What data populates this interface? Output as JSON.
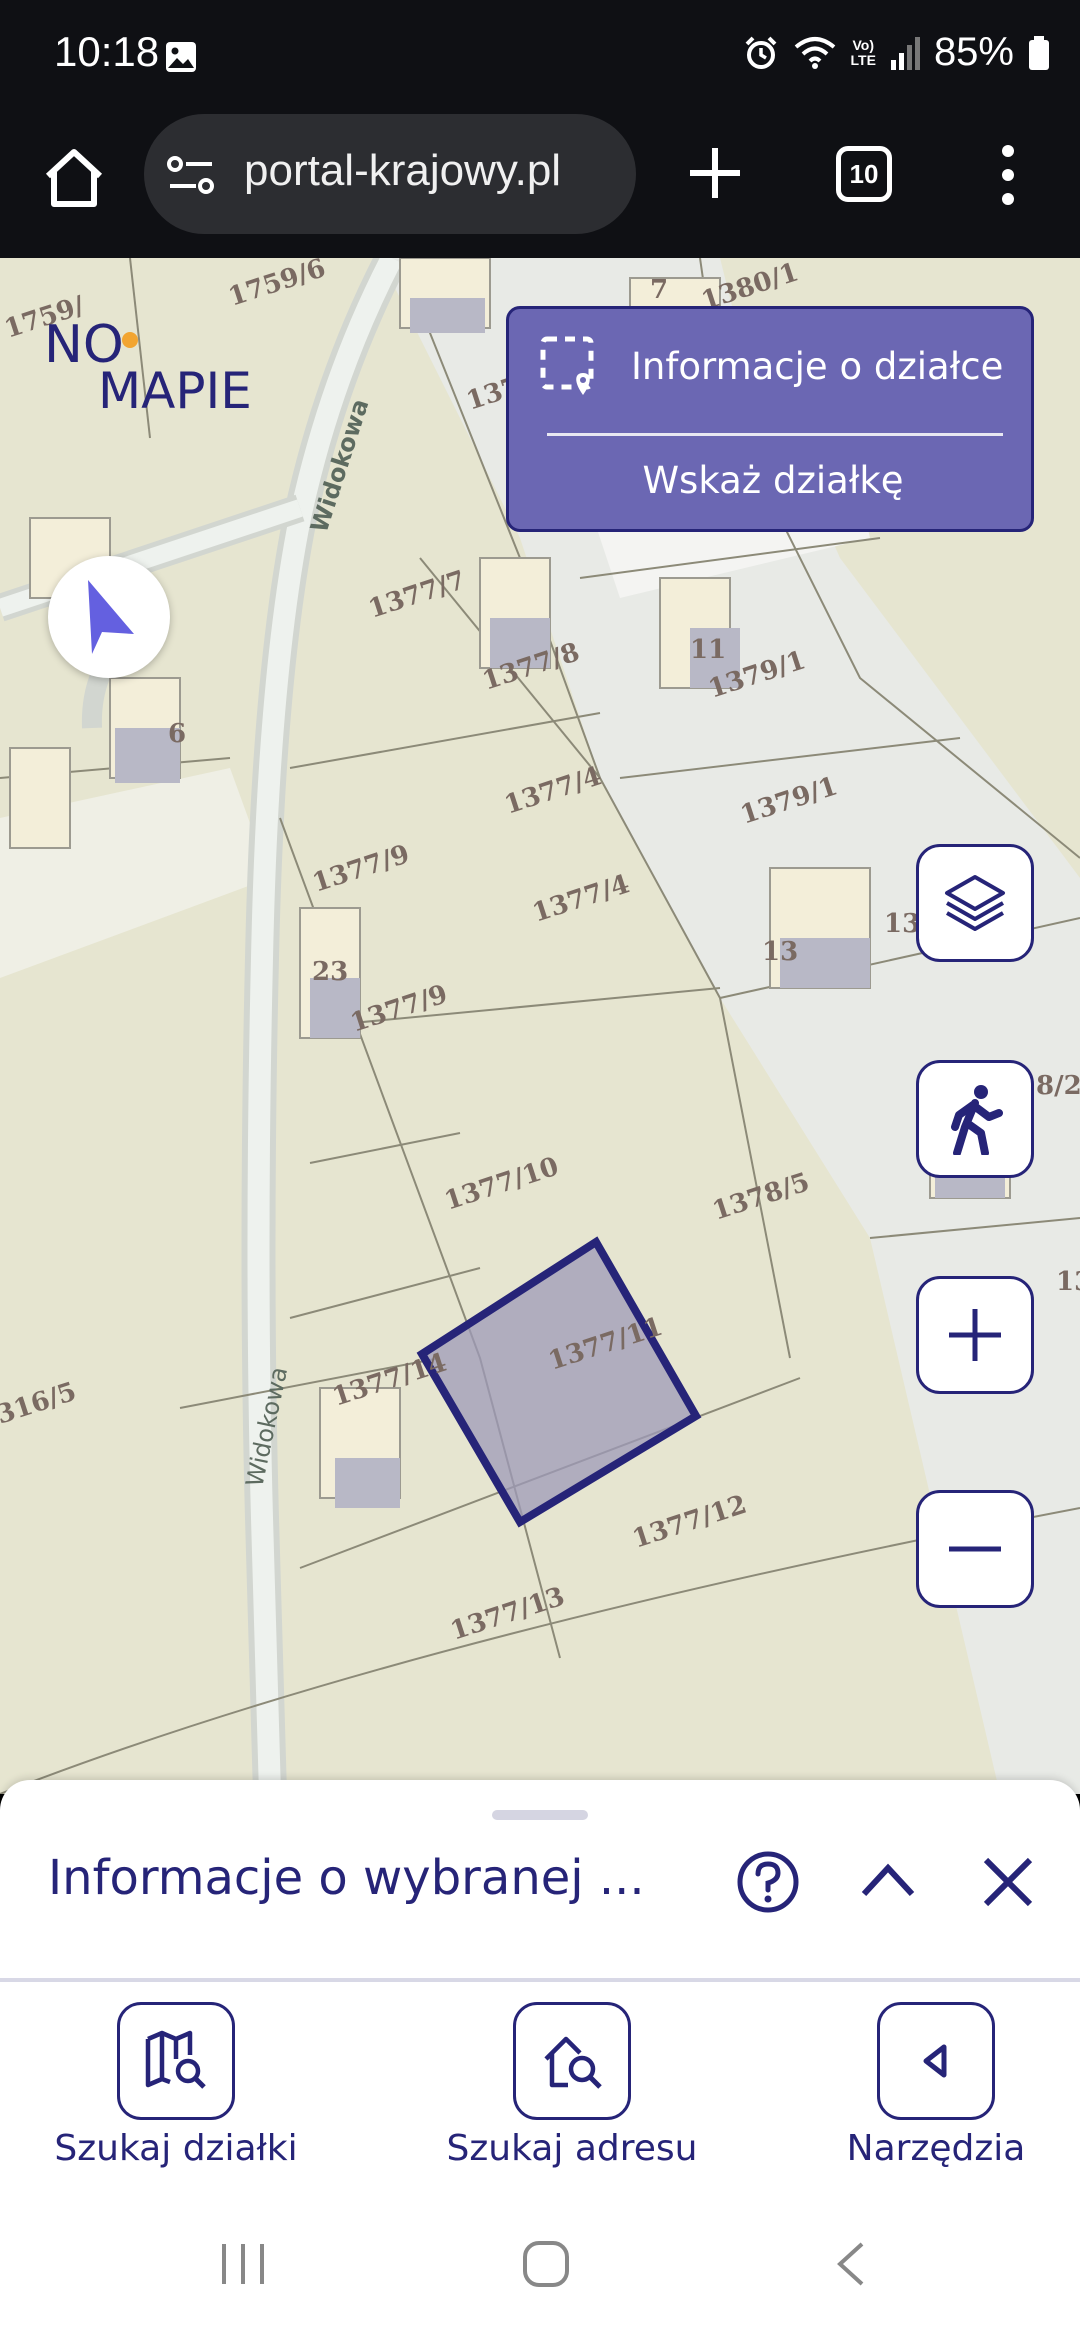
{
  "status_bar": {
    "time": "10:18",
    "battery": "85%",
    "icons": [
      "photo-icon",
      "alarm-icon",
      "wifi-icon",
      "volte-icon",
      "signal-icon",
      "battery-icon"
    ],
    "volte_top": "Vo)",
    "volte_bottom": "LTE"
  },
  "browser": {
    "url": "portal-krajowy.pl",
    "tab_count": "10"
  },
  "map": {
    "logo_top": "NO",
    "logo_bottom": "MAPIE",
    "info_card": {
      "title": "Informacje o działce",
      "action": "Wskaż działkę"
    },
    "street_label": "Widokowa",
    "parcel_labels": [
      "1759/6",
      "1759/",
      "1380/1",
      "7",
      "137",
      "1377/7",
      "1377/8",
      "11",
      "1379/1",
      "6",
      "1377/4",
      "1379/1",
      "1377/9",
      "1377/4",
      "23",
      "13",
      "13",
      "1377/9",
      "8/2",
      "1377/10",
      "1378/5",
      "13",
      "1377/11",
      "1377/14",
      "316/5",
      "1377/12",
      "1377/13",
      "Widokowa"
    ],
    "selected_parcel": "1377/11",
    "colors": {
      "accent": "#262478",
      "card_bg": "#6b67b3",
      "selection_fill": "#9e9ab8"
    }
  },
  "sheet": {
    "title": "Informacje o wybranej ..."
  },
  "bottom_nav": {
    "search_parcel": "Szukaj działki",
    "search_address": "Szukaj adresu",
    "tools": "Narzędzia"
  }
}
